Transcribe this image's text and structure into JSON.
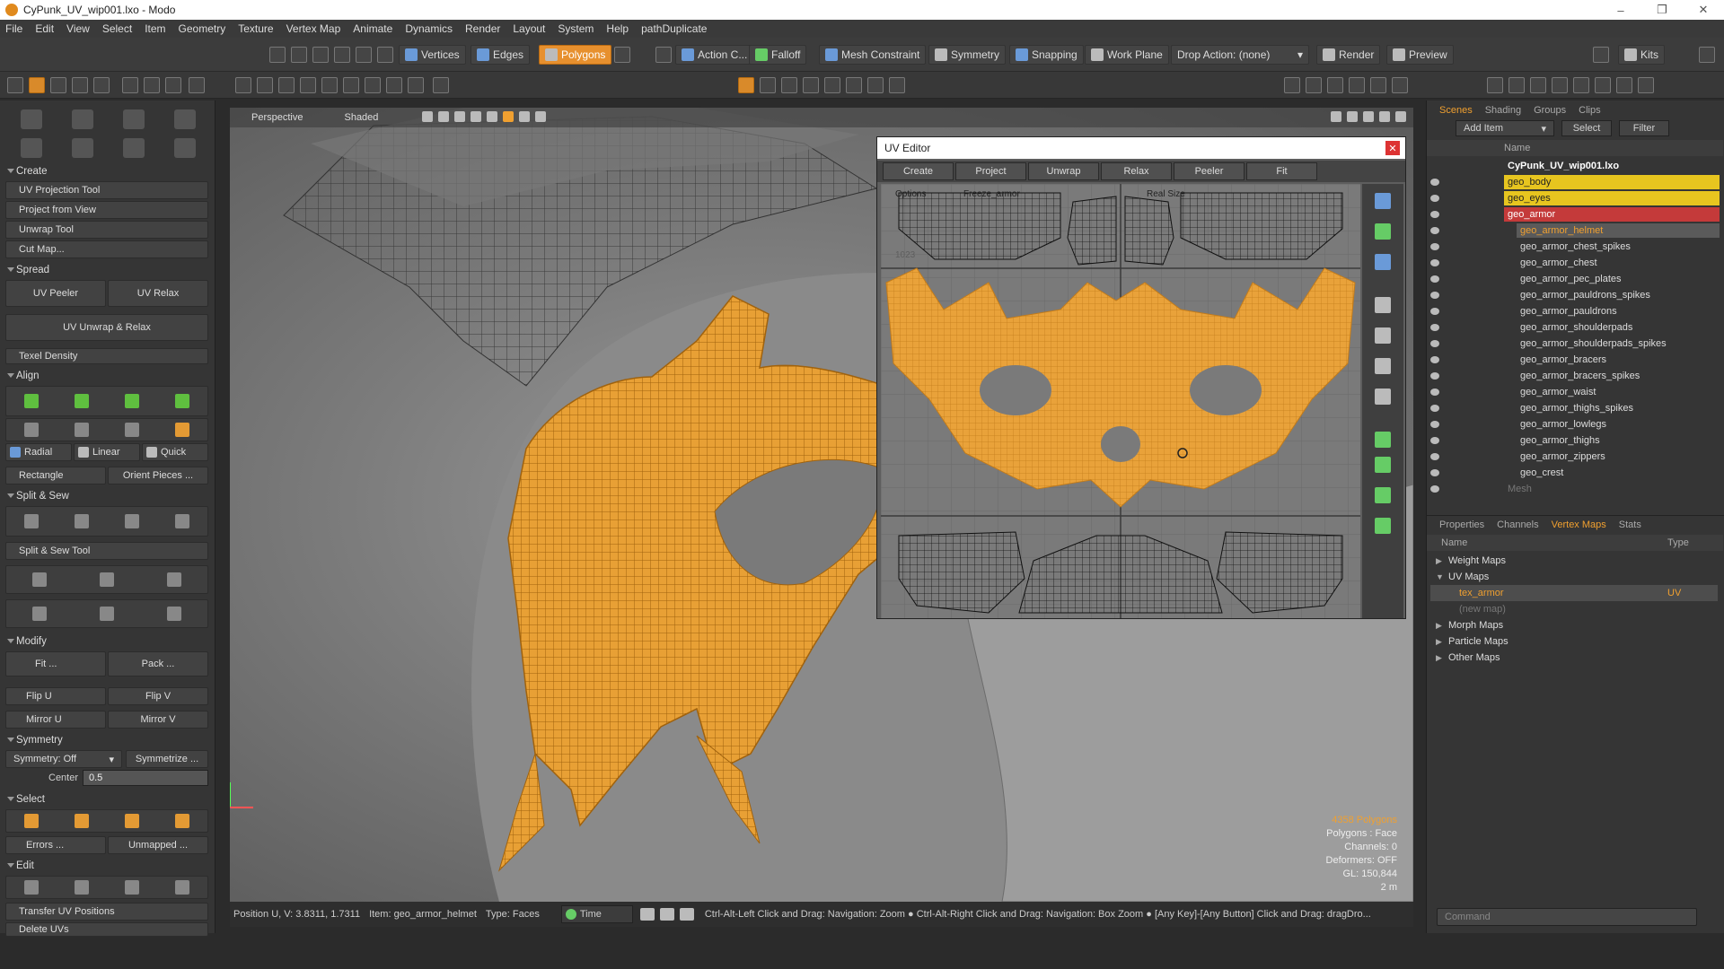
{
  "window": {
    "title": "CyPunk_UV_wip001.lxo - Modo"
  },
  "menu": [
    "File",
    "Edit",
    "View",
    "Select",
    "Item",
    "Geometry",
    "Texture",
    "Vertex Map",
    "Animate",
    "Dynamics",
    "Render",
    "Layout",
    "System",
    "Help",
    "pathDuplicate"
  ],
  "toolbar": {
    "vertices": "Vertices",
    "edges": "Edges",
    "polygons": "Polygons",
    "action_center": "Action C...",
    "falloff": "Falloff",
    "mesh_constraint": "Mesh Constraint",
    "symmetry": "Symmetry",
    "snapping": "Snapping",
    "work_plane": "Work Plane",
    "drop_action": "Drop Action: (none)",
    "render": "Render",
    "preview": "Preview",
    "kits": "Kits"
  },
  "left": {
    "create_header": "Create",
    "create_items": [
      "UV Projection Tool",
      "Project from View",
      "Unwrap Tool",
      "Cut Map..."
    ],
    "spread_header": "Spread",
    "uv_peeler": "UV Peeler",
    "uv_relax": "UV Relax",
    "uv_unwrap_relax": "UV Unwrap & Relax",
    "texel_density": "Texel Density",
    "align_header": "Align",
    "radial": "Radial",
    "linear": "Linear",
    "quick": "Quick",
    "rectangle": "Rectangle",
    "orient_pieces": "Orient Pieces ...",
    "split_sew_header": "Split & Sew",
    "split_sew_tool": "Split & Sew Tool",
    "modify_header": "Modify",
    "fit": "Fit ...",
    "pack": "Pack ...",
    "flip_u": "Flip U",
    "flip_v": "Flip V",
    "mirror_u": "Mirror U",
    "mirror_v": "Mirror V",
    "symmetry_header": "Symmetry",
    "symmetry_off": "Symmetry: Off",
    "symmetrize": "Symmetrize ...",
    "center_label": "Center",
    "center_value": "0.5",
    "select_header": "Select",
    "errors": "Errors ...",
    "unmapped": "Unmapped ...",
    "edit_header": "Edit",
    "transfer_uv": "Transfer UV Positions",
    "delete_uvs": "Delete UVs"
  },
  "viewport": {
    "mode": "Perspective",
    "shading": "Shaded",
    "stats": [
      "4358 Polygons",
      "Polygons : Face",
      "Channels: 0",
      "Deformers: OFF",
      "GL: 150,844",
      "2 m"
    ]
  },
  "uv_editor": {
    "title": "UV Editor",
    "tabs": [
      "Create",
      "Project",
      "Unwrap",
      "Relax",
      "Peeler",
      "Fit"
    ],
    "inner_labels": {
      "a": "Options",
      "b": "Freeze_armor",
      "c": "Real Size"
    },
    "tick": "1023"
  },
  "statusbar": {
    "position": "Position U, V:  3.8311, 1.7311",
    "item": "Item: geo_armor_helmet",
    "type": "Type: Faces",
    "time": "Time",
    "hints": "Ctrl-Alt-Left Click and Drag: Navigation: Zoom  ●  Ctrl-Alt-Right Click and Drag: Navigation: Box Zoom  ●  [Any Key]-[Any Button] Click and Drag: dragDro..."
  },
  "right": {
    "top_tabs": [
      "Scenes",
      "Shading",
      "Groups",
      "Clips"
    ],
    "add_item": "Add Item",
    "select": "Select",
    "filter": "Filter",
    "name_col": "Name",
    "scene_root": "CyPunk_UV_wip001.lxo",
    "items": [
      {
        "name": "geo_body",
        "style": "yellow",
        "indent": 1
      },
      {
        "name": "geo_eyes",
        "style": "yellow",
        "indent": 1
      },
      {
        "name": "geo_armor",
        "style": "red",
        "indent": 1
      },
      {
        "name": "geo_armor_helmet",
        "style": "orange",
        "indent": 2
      },
      {
        "name": "geo_armor_chest_spikes",
        "style": "",
        "indent": 2
      },
      {
        "name": "geo_armor_chest",
        "style": "",
        "indent": 2
      },
      {
        "name": "geo_armor_pec_plates",
        "style": "",
        "indent": 2
      },
      {
        "name": "geo_armor_pauldrons_spikes",
        "style": "",
        "indent": 2
      },
      {
        "name": "geo_armor_pauldrons",
        "style": "",
        "indent": 2
      },
      {
        "name": "geo_armor_shoulderpads",
        "style": "",
        "indent": 2
      },
      {
        "name": "geo_armor_shoulderpads_spikes",
        "style": "",
        "indent": 2
      },
      {
        "name": "geo_armor_bracers",
        "style": "",
        "indent": 2
      },
      {
        "name": "geo_armor_bracers_spikes",
        "style": "",
        "indent": 2
      },
      {
        "name": "geo_armor_waist",
        "style": "",
        "indent": 2
      },
      {
        "name": "geo_armor_thighs_spikes",
        "style": "",
        "indent": 2
      },
      {
        "name": "geo_armor_lowlegs",
        "style": "",
        "indent": 2
      },
      {
        "name": "geo_armor_thighs",
        "style": "",
        "indent": 2
      },
      {
        "name": "geo_armor_zippers",
        "style": "",
        "indent": 2
      },
      {
        "name": "geo_crest",
        "style": "",
        "indent": 2
      },
      {
        "name": "Mesh",
        "style": "dim",
        "indent": 1
      }
    ],
    "lower_tabs": [
      "Properties",
      "Channels",
      "Vertex Maps",
      "Stats"
    ],
    "vm_name_col": "Name",
    "vm_type_col": "Type",
    "vmaps": [
      {
        "name": "Weight Maps",
        "type": "",
        "style": "group"
      },
      {
        "name": "UV Maps",
        "type": "",
        "style": "group-open"
      },
      {
        "name": "tex_armor",
        "type": "UV",
        "style": "selected"
      },
      {
        "name": "(new map)",
        "type": "",
        "style": "dim"
      },
      {
        "name": "Morph Maps",
        "type": "",
        "style": "group"
      },
      {
        "name": "Particle Maps",
        "type": "",
        "style": "group"
      },
      {
        "name": "Other Maps",
        "type": "",
        "style": "group"
      }
    ],
    "command_placeholder": "Command"
  },
  "colors": {
    "accent": "#e7902e",
    "selection": "#f0a030",
    "scene_yellow": "#e7c51f",
    "scene_red": "#c43a3a"
  }
}
